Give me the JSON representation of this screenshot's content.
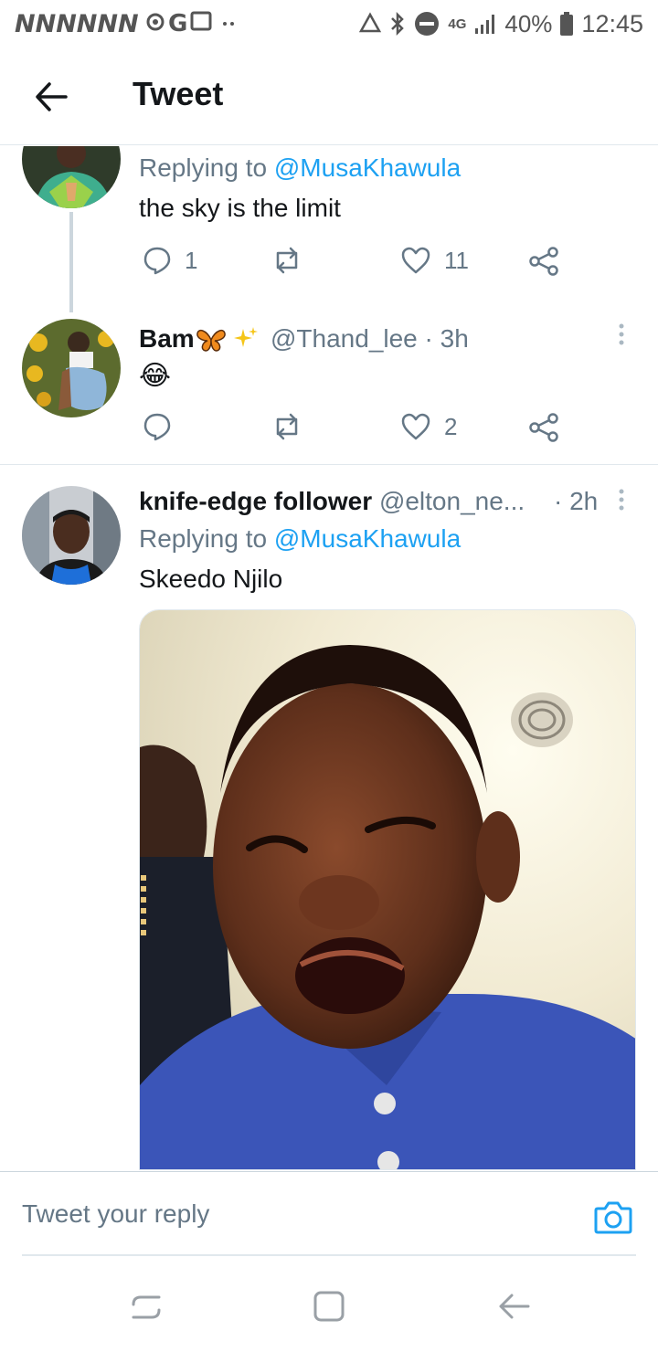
{
  "status_bar": {
    "left_glyphs": "NNNNNN",
    "network": "4G",
    "battery": "40%",
    "time": "12:45"
  },
  "header": {
    "title": "Tweet"
  },
  "tweets": [
    {
      "replying_label": "Replying to ",
      "replying_handle": "@MusaKhawula",
      "text": "the sky is the limit",
      "replies": "1",
      "retweets": "",
      "likes": "11"
    },
    {
      "name": "Bam",
      "handle": "@Thand_lee",
      "time": "· 3h",
      "text": "😂",
      "replies": "",
      "retweets": "",
      "likes": "2"
    },
    {
      "name": "knife-edge follower",
      "handle": "@elton_ne...",
      "time": "· 2h",
      "replying_label": "Replying to ",
      "replying_handle": "@MusaKhawula",
      "text": "Skeedo Njilo"
    }
  ],
  "reply_bar": {
    "placeholder": "Tweet your reply"
  },
  "colors": {
    "accent": "#1da1f2",
    "muted": "#657786",
    "text": "#14171a",
    "divider": "#e1e8ed"
  },
  "icons": {
    "back": "arrow-left-icon",
    "reply": "speech-bubble-icon",
    "retweet": "retweet-icon",
    "like": "heart-icon",
    "share": "share-icon",
    "more": "more-vertical-icon",
    "camera": "camera-icon"
  }
}
